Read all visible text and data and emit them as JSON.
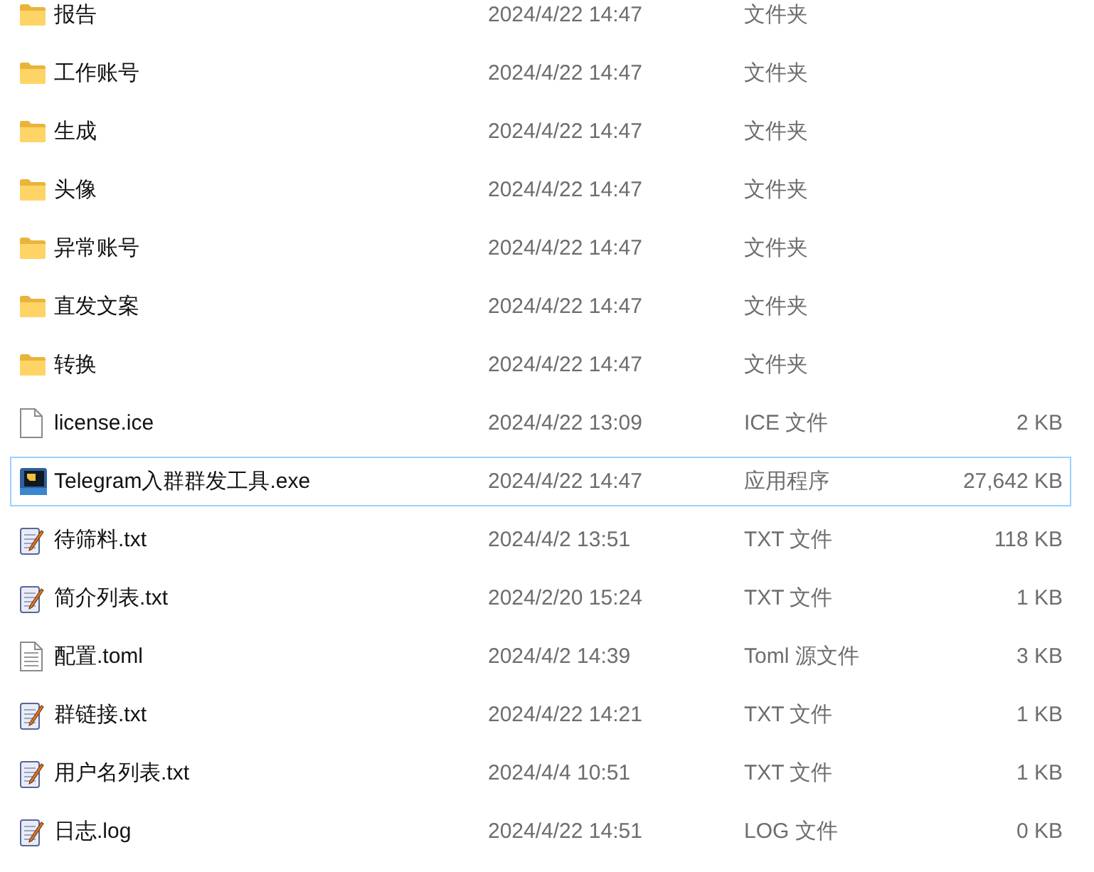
{
  "files": [
    {
      "name": "报告",
      "modified": "2024/4/22 14:47",
      "type": "文件夹",
      "kind": "folder",
      "selected": false
    },
    {
      "name": "工作账号",
      "modified": "2024/4/22 14:47",
      "type": "文件夹",
      "kind": "folder",
      "selected": false
    },
    {
      "name": "生成",
      "modified": "2024/4/22 14:47",
      "type": "文件夹",
      "kind": "folder",
      "selected": false
    },
    {
      "name": "头像",
      "modified": "2024/4/22 14:47",
      "type": "文件夹",
      "kind": "folder",
      "selected": false
    },
    {
      "name": "异常账号",
      "modified": "2024/4/22 14:47",
      "type": "文件夹",
      "kind": "folder",
      "selected": false
    },
    {
      "name": "直发文案",
      "modified": "2024/4/22 14:47",
      "type": "文件夹",
      "kind": "folder",
      "selected": false
    },
    {
      "name": "转换",
      "modified": "2024/4/22 14:47",
      "type": "文件夹",
      "kind": "folder",
      "selected": false
    },
    {
      "name": "license.ice",
      "modified": "2024/4/22 13:09",
      "type": "ICE 文件",
      "size": "2 KB",
      "kind": "blank",
      "selected": false
    },
    {
      "name": "Telegram入群群发工具.exe",
      "modified": "2024/4/22 14:47",
      "type": "应用程序",
      "size": "27,642 KB",
      "kind": "app",
      "selected": true
    },
    {
      "name": "待筛料.txt",
      "modified": "2024/4/2 13:51",
      "type": "TXT 文件",
      "size": "118 KB",
      "kind": "text",
      "selected": false
    },
    {
      "name": "简介列表.txt",
      "modified": "2024/2/20 15:24",
      "type": "TXT 文件",
      "size": "1 KB",
      "kind": "text",
      "selected": false
    },
    {
      "name": "配置.toml",
      "modified": "2024/4/2 14:39",
      "type": "Toml 源文件",
      "size": "3 KB",
      "kind": "lined",
      "selected": false
    },
    {
      "name": "群链接.txt",
      "modified": "2024/4/22 14:21",
      "type": "TXT 文件",
      "size": "1 KB",
      "kind": "text",
      "selected": false
    },
    {
      "name": "用户名列表.txt",
      "modified": "2024/4/4 10:51",
      "type": "TXT 文件",
      "size": "1 KB",
      "kind": "text",
      "selected": false
    },
    {
      "name": "日志.log",
      "modified": "2024/4/22 14:51",
      "type": "LOG 文件",
      "size": "0 KB",
      "kind": "text",
      "selected": false
    }
  ]
}
